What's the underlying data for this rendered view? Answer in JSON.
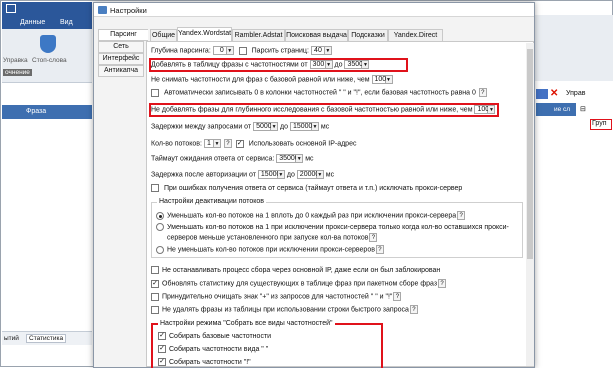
{
  "bg": {
    "tabs": [
      "Данные",
      "Вид"
    ],
    "stop_words": "Стоп-слова",
    "left_lbls": [
      "Управка",
      "очнение"
    ],
    "grid_header": "Фраза",
    "bottom_tabs": [
      "ытий",
      "Статистика"
    ],
    "right_panel": {
      "title": "Управ",
      "col_header": "ие сл",
      "group": "Груп"
    }
  },
  "dialog": {
    "title": "Настройки",
    "side_tabs": [
      "Парсинг",
      "Сеть",
      "Интерфейс",
      "Антикапча"
    ],
    "top_tabs": [
      "Общие",
      "Yandex.Wordstat",
      "Rambler.Adstat",
      "Поисковая выдача",
      "Подсказки",
      "Yandex.Direct"
    ],
    "depth_label": "Глубина парсинга:",
    "depth_value": "0",
    "pages_label": "Парсить страниц:",
    "pages_value": "40",
    "add_label": "Добавлять в таблицу фразы с частотностями от",
    "add_from": "300",
    "add_to_label": "до",
    "add_to": "3500",
    "nochange_label": "Не снимать частотности для фраз с базовой равной или ниже, чем",
    "nochange_value": "100",
    "auto0_label": "Автоматически записывать 0 в колонки частотностей \" \" и \"!\", если базовая частотность равна 0",
    "nodeep_label": "Не добавлять фразы для глубинного исследования с базовой частотностью равной или ниже, чем",
    "nodeep_value": "100",
    "delay_label": "Задержки между запросами от",
    "delay_from": "5000",
    "delay_to_label": "до",
    "delay_to": "15000",
    "delay_unit": "мс",
    "threads_label": "Кол-во потоков:",
    "threads_value": "1",
    "use_main_ip": "Использовать основной IP-адрес",
    "timeout_label": "Таймаут ожидания ответа от сервиса:",
    "timeout_value": "35000",
    "timeout_unit": "мс",
    "authdelay_label": "Задержка после авторизации от",
    "authdelay_from": "15000",
    "authdelay_to_label": "до",
    "authdelay_to": "20000",
    "authdelay_unit": "мс",
    "errexclude": "При ошибках получения ответа от сервиса (таймаут ответа и т.п.) исключать прокси-сервер",
    "deact_caption": "Настройки деактивации потоков",
    "deact_opt1": "Уменьшать кол-во потоков на 1 вплоть до 0 каждый раз при исключении прокси-сервера",
    "deact_opt2a": "Уменьшать кол-во потоков на 1 при исключении прокси-сервера только когда кол-во оставшихся прокси-",
    "deact_opt2b": "серверов меньше установленного при запуске кол-ва потоков",
    "deact_opt3": "Не уменьшать кол-во потоков при исключении прокси-серверов",
    "nostop": "Не останавливать процесс сбора через основной IP, даже если он был заблокирован",
    "updatestats": "Обновлять статистику для существующих в таблице фраз при пакетном сборе фраз",
    "forceclean": "Принудительно очищать знак \"+\" из запросов для частотностей \" \" и \"!\"",
    "nodelete": "Не удалять фразы из таблицы при использовании строки быстрого запроса",
    "collect_caption": "Настройки режима \"Собрать все виды частотностей\"",
    "collect1": "Собирать базовые частотности",
    "collect2": "Собирать частотности вида \" \"",
    "collect3": "Собирать частотности \"!\""
  }
}
